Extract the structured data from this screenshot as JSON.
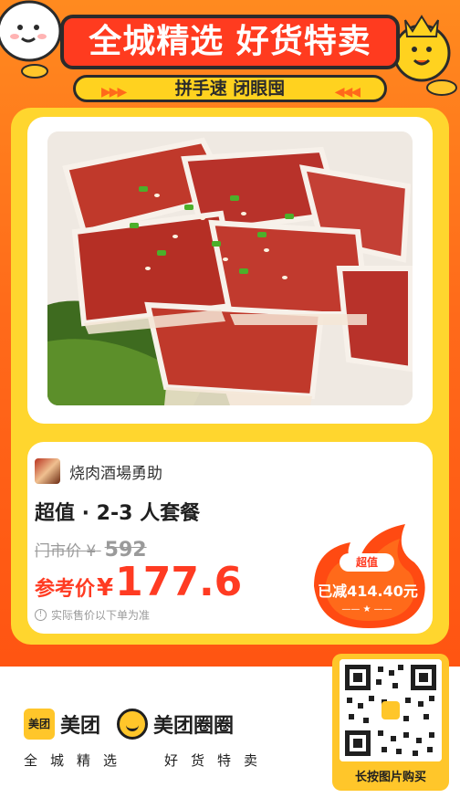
{
  "header": {
    "title": "全城精选 好货特卖",
    "subtitle": "拼手速 闭眼囤",
    "arrows_left": "▶▶▶",
    "arrows_right": "◀◀◀"
  },
  "deal": {
    "shop_name": "烧肉酒場勇助",
    "title": "超值 · 2-3 人套餐",
    "original_price_label": "门市价",
    "original_price_currency": "¥",
    "original_price": "592",
    "ref_price_label": "参考价",
    "ref_price_currency": "¥",
    "ref_price": "177.6",
    "note": "实际售价以下单为准",
    "note_icon": "!"
  },
  "badge": {
    "tag": "超值",
    "discount": "已减414.40元",
    "line": "—— ★ ——"
  },
  "footer": {
    "brand_badge": "美团",
    "brand_name": "美团",
    "brand_name2": "美团圈圈",
    "slogan_left": "全城精选",
    "slogan_right": "好货特卖",
    "qr_label": "长按图片购买"
  },
  "colors": {
    "background_orange": "#ff6a1a",
    "frame_yellow": "#ffd62e",
    "banner_red": "#ff3b1f",
    "price_red": "#ff3b22",
    "brand_yellow": "#ffc62a"
  },
  "icons": {
    "mascot_left": "smiling-egg-mascot",
    "mascot_right": "crowned-yellow-mascot",
    "note": "info-icon",
    "flame": "flame-badge",
    "quan": "smile-circle-icon"
  }
}
